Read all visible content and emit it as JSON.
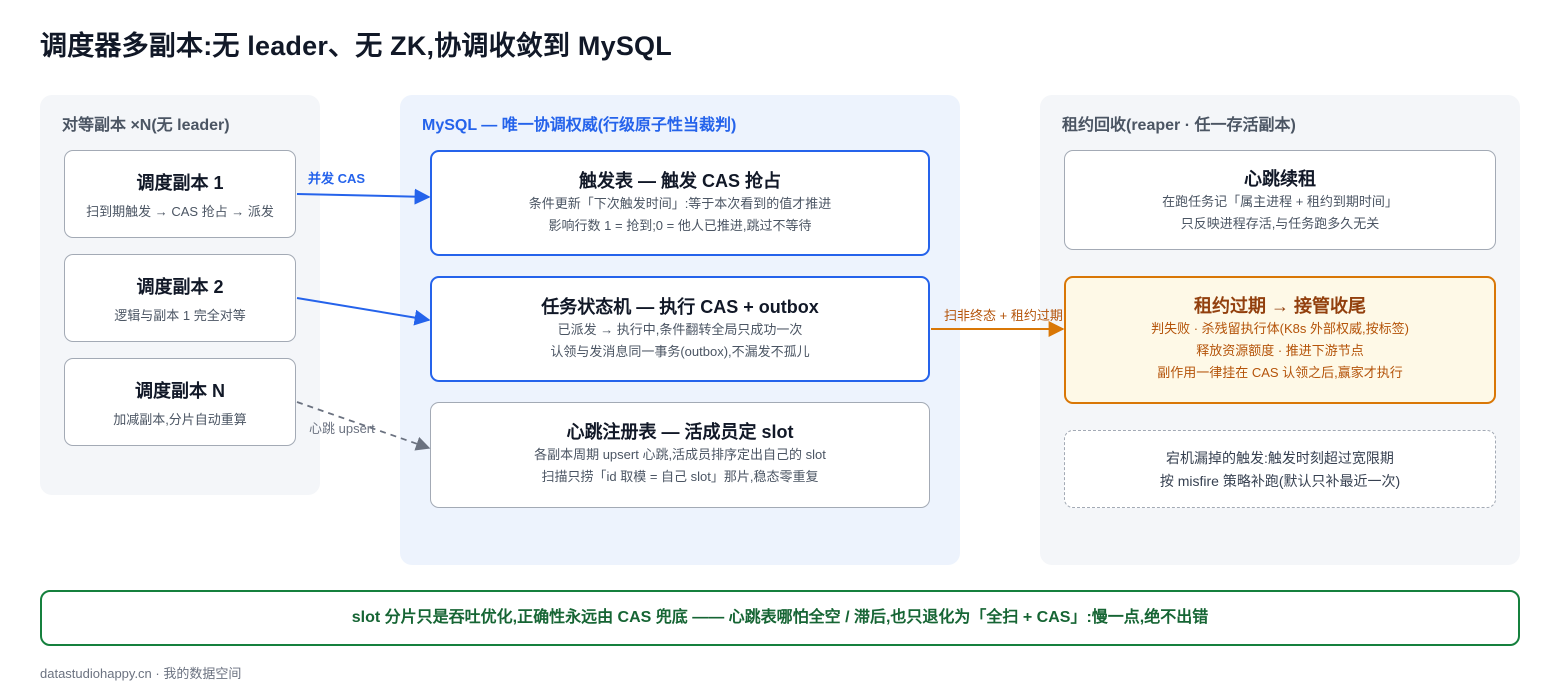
{
  "title": "调度器多副本:无 leader、无 ZK,协调收敛到 MySQL",
  "left_panel": {
    "title": "对等副本 ×N(无 leader)",
    "replicas": [
      {
        "title": "调度副本 1",
        "desc": "扫到期触发 → CAS 抢占 → 派发"
      },
      {
        "title": "调度副本 2",
        "desc": "逻辑与副本 1 完全对等"
      },
      {
        "title": "调度副本 N",
        "desc": "加减副本,分片自动重算"
      }
    ]
  },
  "mid_panel": {
    "title": "MySQL — 唯一协调权威(行级原子性当裁判)",
    "boxes": [
      {
        "title": "触发表 — 触发 CAS 抢占",
        "lines": [
          "条件更新「下次触发时间」:等于本次看到的值才推进",
          "影响行数 1 = 抢到;0 = 他人已推进,跳过不等待"
        ]
      },
      {
        "title": "任务状态机 — 执行 CAS + outbox",
        "lines": [
          "已派发 → 执行中,条件翻转全局只成功一次",
          "认领与发消息同一事务(outbox),不漏发不孤儿"
        ]
      },
      {
        "title": "心跳注册表 — 活成员定 slot",
        "lines": [
          "各副本周期 upsert 心跳,活成员排序定出自己的 slot",
          "扫描只捞「id 取模 = 自己 slot」那片,稳态零重复"
        ]
      }
    ]
  },
  "right_panel": {
    "title": "租约回收(reaper · 任一存活副本)",
    "heartbeat": {
      "title": "心跳续租",
      "lines": [
        "在跑任务记「属主进程 + 租约到期时间」",
        "只反映进程存活,与任务跑多久无关"
      ]
    },
    "lease": {
      "title": "租约过期 → 接管收尾",
      "lines": [
        "判失败 · 杀残留执行体(K8s 外部权威,按标签)",
        "释放资源额度 · 推进下游节点",
        "副作用一律挂在 CAS 认领之后,赢家才执行"
      ]
    },
    "misfire": {
      "lines": [
        "宕机漏掉的触发:触发时刻超过宽限期",
        "按 misfire 策略补跑(默认只补最近一次)"
      ]
    }
  },
  "edge_labels": {
    "concurrent_cas": "并发 CAS",
    "heartbeat_upsert": "心跳 upsert",
    "scan_non_terminal": "扫非终态 + 租约过期"
  },
  "footer": "slot 分片只是吞吐优化,正确性永远由 CAS 兜底 —— 心跳表哪怕全空 / 滞后,也只退化为「全扫 + CAS」:慢一点,绝不出错",
  "source": "datastudiohappy.cn · 我的数据空间",
  "colors": {
    "accent_blue": "#2563eb",
    "accent_orange": "#d97706",
    "accent_green": "#15803d",
    "neutral_border": "#a3aab5"
  }
}
